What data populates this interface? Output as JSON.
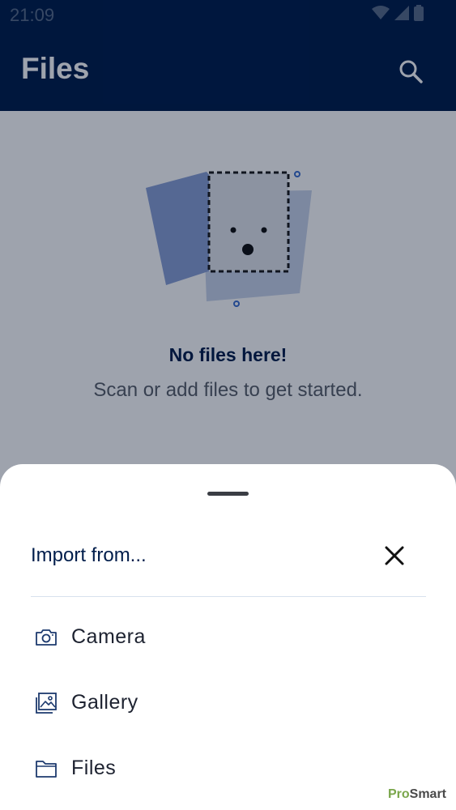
{
  "status_bar": {
    "time": "21:09"
  },
  "app_bar": {
    "title": "Files",
    "search_icon": "search-icon"
  },
  "empty_state": {
    "title": "No files here!",
    "subtitle": "Scan or add files to get started."
  },
  "bottom_sheet": {
    "title": "Import from...",
    "close_icon": "close-icon",
    "items": [
      {
        "label": "Camera",
        "icon": "camera-icon"
      },
      {
        "label": "Gallery",
        "icon": "gallery-icon"
      },
      {
        "label": "Files",
        "icon": "folder-icon"
      }
    ]
  },
  "watermark": {
    "prefix": "Pro",
    "suffix": "Smart"
  },
  "colors": {
    "app_bar": "#001d4b",
    "accent_text": "#001d4b",
    "scrim": "rgba(0,12,40,0.38)"
  }
}
